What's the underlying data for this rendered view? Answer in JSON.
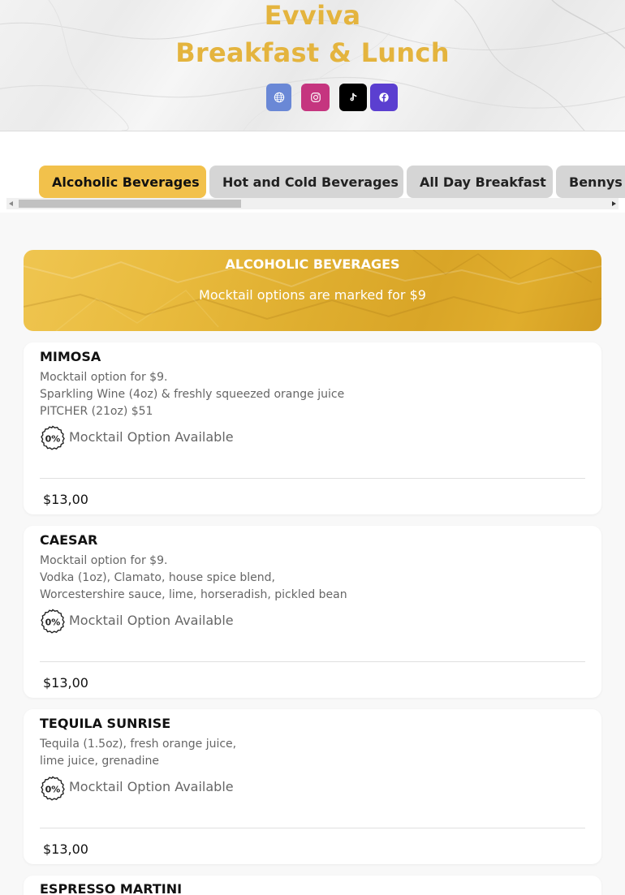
{
  "header": {
    "title_line1": "Evviva",
    "title_line2": "Breakfast & Lunch",
    "socials": [
      {
        "name": "globe-icon",
        "color": "#6a88d6"
      },
      {
        "name": "instagram-icon",
        "color": "#c5357f"
      },
      {
        "name": "tiktok-icon",
        "color": "#000000"
      },
      {
        "name": "facebook-icon",
        "color": "#5b3fd0"
      }
    ]
  },
  "tabs": [
    {
      "label": "Alcoholic Beverages",
      "active": true
    },
    {
      "label": "Hot and Cold Beverages",
      "active": false
    },
    {
      "label": "All Day Breakfast",
      "active": false
    },
    {
      "label": "Bennys",
      "active": false
    }
  ],
  "category": {
    "title": "ALCOHOLIC BEVERAGES",
    "subtitle": "Mocktail options are marked for $9"
  },
  "items": [
    {
      "name": "MIMOSA",
      "desc": [
        "Mocktail option for $9.",
        "Sparkling Wine (4oz) & freshly squeezed orange juice",
        "PITCHER (21oz) $51"
      ],
      "badge": "Mocktail Option Available",
      "badge_icon": "0%",
      "price": "$13,00"
    },
    {
      "name": "CAESAR",
      "desc": [
        "Mocktail option for $9.",
        "Vodka (1oz), Clamato, house spice blend,",
        "Worcestershire sauce, lime, horseradish, pickled bean"
      ],
      "badge": "Mocktail Option Available",
      "badge_icon": "0%",
      "price": "$13,00"
    },
    {
      "name": "TEQUILA SUNRISE",
      "desc": [
        "Tequila (1.5oz), fresh orange juice,",
        "lime juice, grenadine"
      ],
      "badge": "Mocktail Option Available",
      "badge_icon": "0%",
      "price": "$13,00"
    },
    {
      "name": "ESPRESSO MARTINI"
    }
  ],
  "colors": {
    "accent": "#f2c14b",
    "title": "#e4b43e",
    "tab_inactive": "#d5d5d5"
  }
}
